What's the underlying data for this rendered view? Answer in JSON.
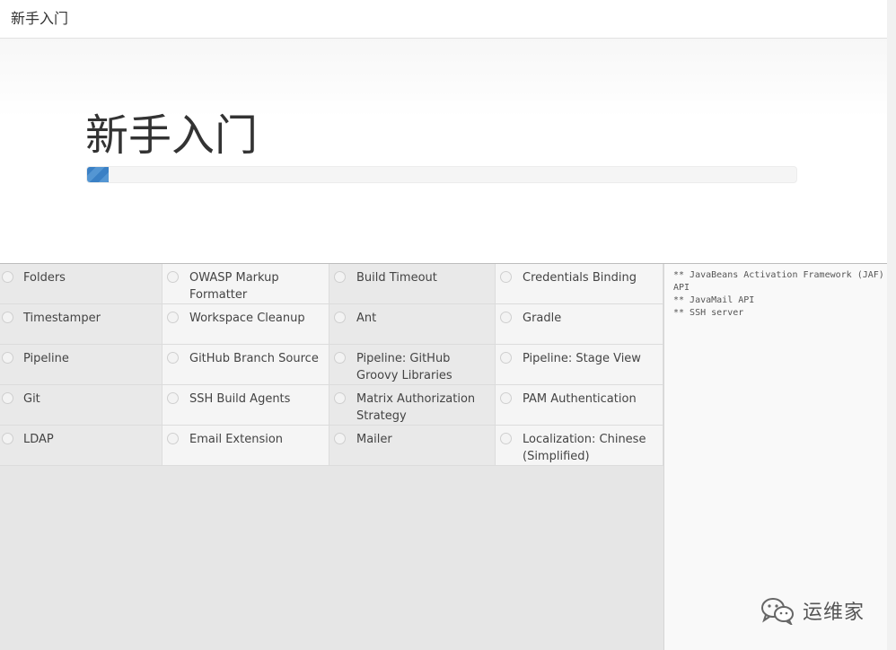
{
  "window": {
    "title": "新手入门"
  },
  "hero": {
    "title": "新手入门",
    "progress_fraction": 0.03
  },
  "plugins": [
    {
      "name": "Folders",
      "shade": true
    },
    {
      "name": "OWASP Markup Formatter",
      "shade": false
    },
    {
      "name": "Build Timeout",
      "shade": true
    },
    {
      "name": "Credentials Binding",
      "shade": false
    },
    {
      "name": "Timestamper",
      "shade": true
    },
    {
      "name": "Workspace Cleanup",
      "shade": false
    },
    {
      "name": "Ant",
      "shade": true
    },
    {
      "name": "Gradle",
      "shade": false
    },
    {
      "name": "Pipeline",
      "shade": true
    },
    {
      "name": "GitHub Branch Source",
      "shade": false
    },
    {
      "name": "Pipeline: GitHub Groovy Libraries",
      "shade": true
    },
    {
      "name": "Pipeline: Stage View",
      "shade": false
    },
    {
      "name": "Git",
      "shade": true
    },
    {
      "name": "SSH Build Agents",
      "shade": false
    },
    {
      "name": "Matrix Authorization Strategy",
      "shade": true
    },
    {
      "name": "PAM Authentication",
      "shade": false
    },
    {
      "name": "LDAP",
      "shade": true
    },
    {
      "name": "Email Extension",
      "shade": false
    },
    {
      "name": "Mailer",
      "shade": true
    },
    {
      "name": "Localization: Chinese (Simplified)",
      "shade": false
    }
  ],
  "install_log": [
    "** JavaBeans Activation Framework (JAF) API",
    "** JavaMail API",
    "** SSH server"
  ],
  "watermark": {
    "text": "运维家",
    "icon": "wechat-icon"
  }
}
